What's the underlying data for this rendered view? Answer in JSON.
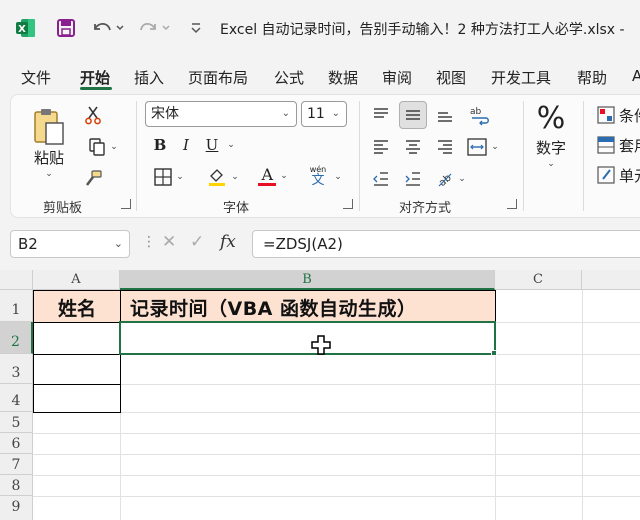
{
  "title": {
    "text": "Excel 自动记录时间，告别手动输入！2 种方法打工人必学.xlsx  -",
    "app_icon": "excel-icon",
    "quick_access": [
      "save-icon",
      "undo-icon",
      "redo-icon",
      "customize-icon"
    ]
  },
  "menu": {
    "items": [
      "文件",
      "开始",
      "插入",
      "页面布局",
      "公式",
      "数据",
      "审阅",
      "视图",
      "开发工具",
      "帮助",
      "A"
    ],
    "active": "开始"
  },
  "ribbon": {
    "clipboard": {
      "paste_label": "粘贴",
      "group_label": "剪贴板"
    },
    "font": {
      "font_name": "宋体",
      "font_size": "11",
      "group_label": "字体",
      "bold": "B",
      "italic": "I",
      "underline": "U",
      "font_color_glyph": "A",
      "phonetic_top": "wén",
      "phonetic_bottom": "文"
    },
    "alignment": {
      "group_label": "对齐方式"
    },
    "number": {
      "label": "数字",
      "glyph": "%"
    },
    "styles": {
      "items": [
        "条件",
        "套用",
        "单元"
      ]
    },
    "accent_color": "#217346",
    "font_color_bar": "#e81123"
  },
  "formula_bar": {
    "name_box": "B2",
    "cancel_glyph": "✕",
    "enter_glyph": "✓",
    "fx_label": "fx",
    "formula": "=ZDSJ(A2)"
  },
  "sheet": {
    "columns": [
      "A",
      "B",
      "C"
    ],
    "rows": [
      "1",
      "2",
      "3",
      "4",
      "5",
      "6",
      "7",
      "8",
      "9"
    ],
    "active_cell": "B2",
    "header_fill_color": "#fde2d2",
    "cells": {
      "A1": "姓名",
      "B1": "记录时间（VBA 函数自动生成）"
    }
  }
}
